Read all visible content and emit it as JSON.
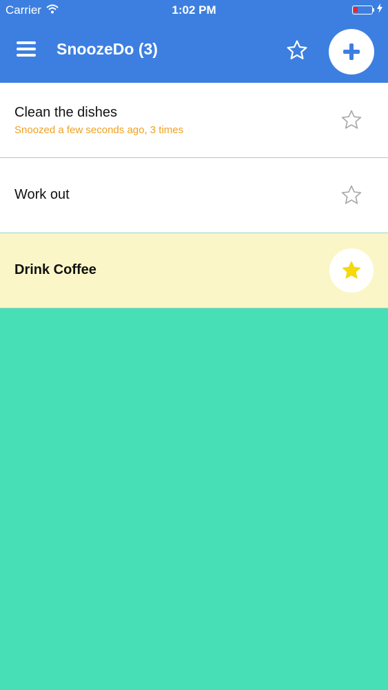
{
  "status_bar": {
    "carrier": "Carrier",
    "time": "1:02 PM",
    "battery_level": 0.22,
    "wifi_icon": "wifi-icon",
    "charging_icon": "bolt-icon"
  },
  "header": {
    "title": "SnoozeDo (3)",
    "menu_icon": "hamburger-menu-icon",
    "favorites_icon": "star-outline-icon",
    "add_icon": "plus-icon",
    "background_color": "#3d7fe0"
  },
  "tasks": [
    {
      "title": "Clean the dishes",
      "subtitle": "Snoozed a few seconds ago, 3 times",
      "starred": false
    },
    {
      "title": "Work out",
      "subtitle": "",
      "starred": false
    },
    {
      "title": "Drink Coffee",
      "subtitle": "",
      "starred": true
    }
  ],
  "colors": {
    "accent": "#3d7fe0",
    "snooze_text": "#f0a020",
    "starred_row": "#faf6c7",
    "star_filled": "#f5d90a",
    "background": "#47dfb5"
  }
}
